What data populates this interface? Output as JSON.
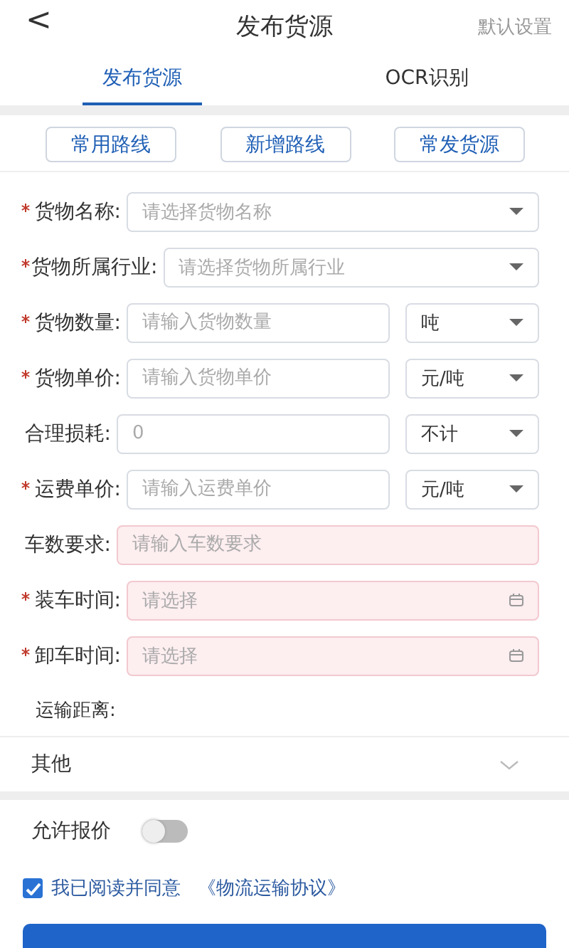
{
  "header": {
    "back": "<",
    "title": "发布货源",
    "action": "默认设置"
  },
  "tabs": [
    {
      "label": "发布货源",
      "selected": true
    },
    {
      "label": "OCR识别",
      "selected": false
    }
  ],
  "quick_buttons": [
    "常用路线",
    "新增路线",
    "常发货源"
  ],
  "fields": [
    {
      "kind": "select",
      "required": true,
      "label": "货物名称:",
      "placeholder": "请选择货物名称",
      "highlighted": false
    },
    {
      "kind": "select",
      "required": true,
      "label": "货物所属行业:",
      "placeholder": "请选择货物所属行业",
      "highlighted": false
    },
    {
      "kind": "input_select",
      "required": true,
      "label": "货物数量:",
      "placeholder": "请输入货物数量",
      "unit": "吨",
      "highlighted": false
    },
    {
      "kind": "input_select",
      "required": true,
      "label": "货物单价:",
      "placeholder": "请输入货物单价",
      "unit": "元/吨",
      "highlighted": false
    },
    {
      "kind": "input_select",
      "required": false,
      "label": "合理损耗:",
      "placeholder": "0",
      "unit": "不计",
      "highlighted": false
    },
    {
      "kind": "input_select",
      "required": true,
      "label": "运费单价:",
      "placeholder": "请输入运费单价",
      "unit": "元/吨",
      "highlighted": false
    },
    {
      "kind": "input",
      "required": false,
      "label": "车数要求:",
      "placeholder": "请输入车数要求",
      "highlighted": true
    },
    {
      "kind": "date",
      "required": true,
      "label": "装车时间:",
      "placeholder": "请选择",
      "highlighted": true
    },
    {
      "kind": "date",
      "required": true,
      "label": "卸车时间:",
      "placeholder": "请选择",
      "highlighted": true
    }
  ],
  "distance": {
    "label": "运输距离:"
  },
  "other": {
    "label": "其他",
    "expanded": false
  },
  "allow_quote": {
    "label": "允许报价",
    "on": false
  },
  "agreement": {
    "checked": true,
    "text": "我已阅读并同意",
    "link": "《物流运输协议》"
  }
}
